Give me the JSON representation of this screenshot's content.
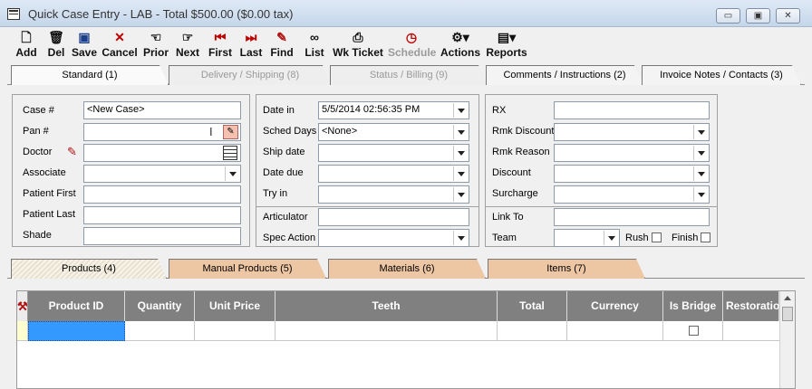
{
  "window": {
    "title": "Quick Case Entry - LAB - Total $500.00 ($0.00 tax)",
    "minimize": "▭",
    "restore": "▣",
    "close": "✕"
  },
  "toolbar": {
    "add": "Add",
    "del": "Del",
    "save": "Save",
    "cancel": "Cancel",
    "prior": "Prior",
    "next": "Next",
    "first": "First",
    "last": "Last",
    "find": "Find",
    "list": "List",
    "wkticket": "Wk Ticket",
    "schedule": "Schedule",
    "actions": "Actions",
    "reports": "Reports"
  },
  "tabs_top": {
    "standard": "Standard (1)",
    "delivery": "Delivery / Shipping (8)",
    "status": "Status / Billing (9)",
    "comments": "Comments / Instructions (2)",
    "invoice": "Invoice Notes / Contacts (3)"
  },
  "left_panel": {
    "case_label": "Case #",
    "case_value": "<New Case>",
    "pan_label": "Pan #",
    "doctor_label": "Doctor",
    "associate_label": "Associate",
    "patient_first_label": "Patient First",
    "patient_last_label": "Patient Last",
    "shade_label": "Shade"
  },
  "middle_panel": {
    "date_in_label": "Date in",
    "date_in_value": "5/5/2014 02:56:35 PM",
    "sched_days_label": "Sched Days",
    "sched_days_value": "<None>",
    "ship_date_label": "Ship date",
    "date_due_label": "Date due",
    "try_in_label": "Try in",
    "articulator_label": "Articulator",
    "spec_action_label": "Spec Action"
  },
  "right_panel": {
    "rx_label": "RX",
    "rmk_discount_label": "Rmk Discount",
    "rmk_reason_label": "Rmk Reason",
    "discount_label": "Discount",
    "surcharge_label": "Surcharge",
    "link_to_label": "Link To",
    "team_label": "Team",
    "rush_label": "Rush",
    "finish_label": "Finish"
  },
  "tabs_bottom": {
    "products": "Products (4)",
    "manual": "Manual Products (5)",
    "materials": "Materials (6)",
    "items": "Items (7)"
  },
  "grid": {
    "columns": [
      "Product ID",
      "Quantity",
      "Unit Price",
      "Teeth",
      "Total",
      "Currency",
      "Is Bridge",
      "Restoration"
    ]
  },
  "colors": {
    "tab_tan": "#edc6a4",
    "grid_header": "#808080",
    "selected_cell": "#3399ff"
  }
}
